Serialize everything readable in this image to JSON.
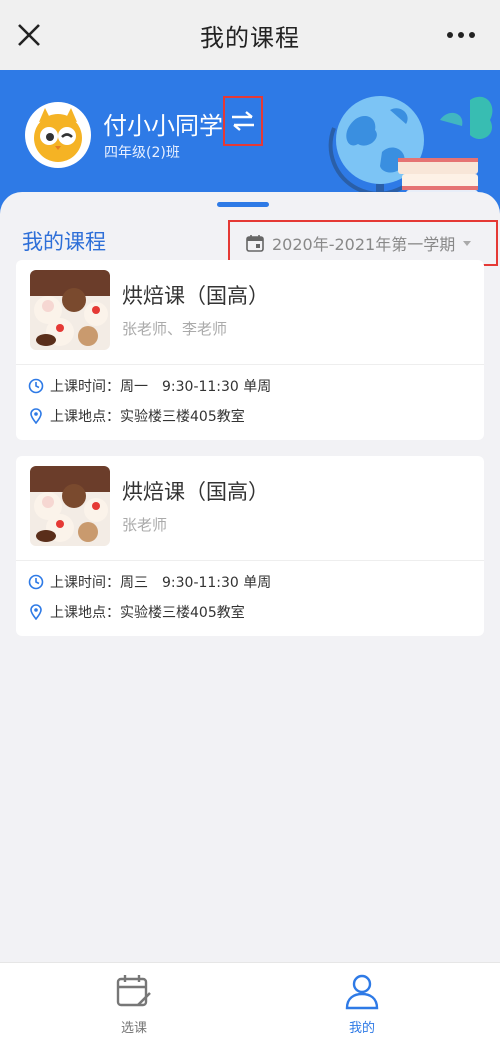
{
  "topbar": {
    "title": "我的课程"
  },
  "header": {
    "student_name": "付小小同学",
    "class_name": "四年级(2)班"
  },
  "panel": {
    "section_title": "我的课程",
    "term": "2020年-2021年第一学期"
  },
  "courses": [
    {
      "name": "烘焙课（国高）",
      "teachers": "张老师、李老师",
      "time_label": "上课时间：",
      "time_value": "周一　9:30-11:30  单周",
      "place_label": "上课地点：",
      "place_value": "实验楼三楼405教室"
    },
    {
      "name": "烘焙课（国高）",
      "teachers": "张老师",
      "time_label": "上课时间：",
      "time_value": "周三　9:30-11:30  单周",
      "place_label": "上课地点：",
      "place_value": "实验楼三楼405教室"
    }
  ],
  "tabbar": {
    "tabs": [
      {
        "label": "选课",
        "icon": "calendar-edit-icon",
        "active": false
      },
      {
        "label": "我的",
        "icon": "user-icon",
        "active": true
      }
    ]
  },
  "colors": {
    "primary": "#2e7ae6",
    "highlight_box": "#e53935",
    "tab_active": "#2e7ae6",
    "tab_inactive": "#777777"
  }
}
